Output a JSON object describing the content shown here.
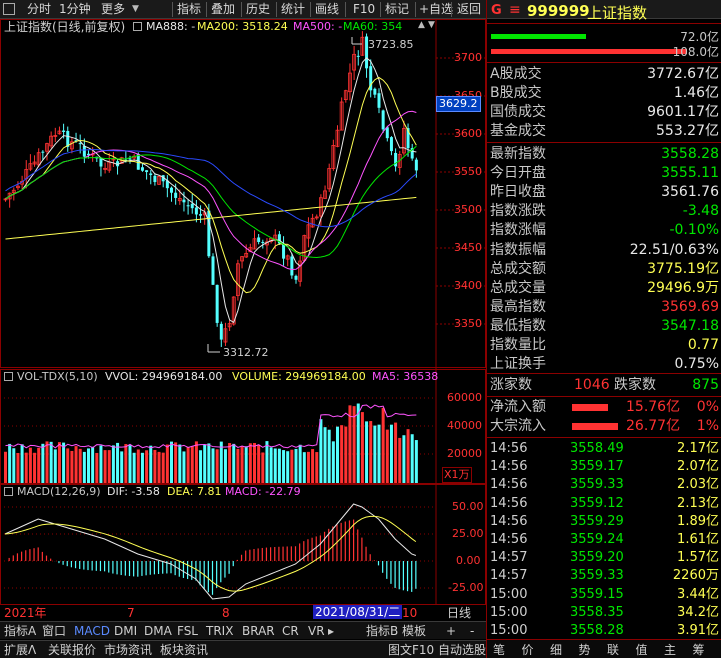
{
  "toolbar": {
    "items": [
      "分时",
      "1分钟",
      "更多",
      "指标",
      "叠加",
      "历史",
      "统计",
      "画线",
      "F10",
      "标记",
      "+自选",
      "返回"
    ]
  },
  "chart": {
    "title": "上证指数(日线,前复权)",
    "ma": [
      {
        "label": "MA888: -",
        "color": "#e8e8e8"
      },
      {
        "label": "MA200: 3518.24",
        "color": "#ffff54"
      },
      {
        "label": "MA500: -",
        "color": "#ff54ff"
      },
      {
        "label": "MA60: 354",
        "color": "#00e600"
      }
    ],
    "price_axis": [
      "3700",
      "3650",
      "3600",
      "3550",
      "3500",
      "3450",
      "3400",
      "3350"
    ],
    "current_price_tag": "3629.2",
    "high_note": "3723.85",
    "low_note": "3312.72",
    "vol_header": [
      {
        "label": "VOL-TDX(5,10)",
        "color": "#c8c8c8"
      },
      {
        "label": "VVOL: 294969184.00",
        "color": "#e8e8e8"
      },
      {
        "label": "VOLUME: 294969184.00",
        "color": "#ffff54"
      },
      {
        "label": "MA5: 36538",
        "color": "#ff54ff"
      }
    ],
    "vol_axis": [
      "60000",
      "40000",
      "20000"
    ],
    "vol_unit": "X1万",
    "macd_header": [
      {
        "label": "MACD(12,26,9)",
        "color": "#c8c8c8"
      },
      {
        "label": "DIF: -3.58",
        "color": "#e8e8e8"
      },
      {
        "label": "DEA: 7.81",
        "color": "#ffff54"
      },
      {
        "label": "MACD: -22.79",
        "color": "#ff54ff"
      }
    ],
    "macd_axis": [
      "50.00",
      "25.00",
      "0.00",
      "-25.00"
    ],
    "date_axis": [
      "2021年",
      "7",
      "8",
      "2021/08/31/二",
      "10"
    ],
    "period_label": "日线"
  },
  "bottom_tabs": [
    "指标A",
    "窗口",
    "MACD",
    "DMI",
    "DMA",
    "FSL",
    "TRIX",
    "BRAR",
    "CR",
    "VR",
    "指标B",
    "模板",
    "+",
    "-"
  ],
  "bottom_tabs2": [
    "扩展Λ",
    "关联报价",
    "市场资讯",
    "板块资讯"
  ],
  "bottom_right": "图文F10 自动选股»",
  "quote": {
    "header_icons": [
      "G",
      "≡"
    ],
    "code": "999999",
    "name": "上证指数",
    "bar_values": [
      "72.0亿",
      "108.0亿"
    ],
    "rows_a": [
      {
        "k": "A股成交",
        "v": "3772.67亿",
        "c": "wht"
      },
      {
        "k": "B股成交",
        "v": "1.46亿",
        "c": "wht"
      },
      {
        "k": "国债成交",
        "v": "9601.17亿",
        "c": "wht"
      },
      {
        "k": "基金成交",
        "v": "553.27亿",
        "c": "wht"
      }
    ],
    "rows_b": [
      {
        "k": "最新指数",
        "v": "3558.28",
        "c": "grn"
      },
      {
        "k": "今日开盘",
        "v": "3555.11",
        "c": "grn"
      },
      {
        "k": "昨日收盘",
        "v": "3561.76",
        "c": "wht"
      },
      {
        "k": "指数涨跌",
        "v": "-3.48",
        "c": "grn"
      },
      {
        "k": "指数涨幅",
        "v": "-0.10%",
        "c": "grn"
      },
      {
        "k": "指数振幅",
        "v": "22.51/0.63%",
        "c": "wht"
      },
      {
        "k": "总成交额",
        "v": "3775.19亿",
        "c": "yel"
      },
      {
        "k": "总成交量",
        "v": "29496.9万",
        "c": "yel"
      },
      {
        "k": "最高指数",
        "v": "3569.69",
        "c": "red"
      },
      {
        "k": "最低指数",
        "v": "3547.18",
        "c": "grn"
      },
      {
        "k": "指数量比",
        "v": "0.77",
        "c": "yel"
      },
      {
        "k": "上证换手",
        "v": "0.75%",
        "c": "wht"
      }
    ],
    "updown": {
      "up_label": "涨家数",
      "up": "1046",
      "down_label": "跌家数",
      "down": "875"
    },
    "flow": [
      {
        "k": "净流入额",
        "v": "15.76亿",
        "pct": "0%"
      },
      {
        "k": "大宗流入",
        "v": "26.77亿",
        "pct": "1%"
      }
    ],
    "ticks": [
      {
        "t": "14:56",
        "p": "3558.49",
        "q": "2.17亿",
        "c": "yel"
      },
      {
        "t": "14:56",
        "p": "3559.17",
        "q": "2.07亿",
        "c": "yel"
      },
      {
        "t": "14:56",
        "p": "3559.33",
        "q": "2.03亿",
        "c": "yel"
      },
      {
        "t": "14:56",
        "p": "3559.12",
        "q": "2.13亿",
        "c": "yel"
      },
      {
        "t": "14:56",
        "p": "3559.29",
        "q": "1.89亿",
        "c": "yel"
      },
      {
        "t": "14:56",
        "p": "3559.24",
        "q": "1.61亿",
        "c": "yel"
      },
      {
        "t": "14:57",
        "p": "3559.20",
        "q": "1.57亿",
        "c": "yel"
      },
      {
        "t": "14:57",
        "p": "3559.33",
        "q": "2260万",
        "c": "yel"
      },
      {
        "t": "15:00",
        "p": "3559.15",
        "q": "3.44亿",
        "c": "yel"
      },
      {
        "t": "15:00",
        "p": "3558.35",
        "q": "34.2亿",
        "c": "yel"
      },
      {
        "t": "15:00",
        "p": "3558.28",
        "q": "3.91亿",
        "c": "yel"
      }
    ],
    "bottom_tabs": [
      "笔",
      "价",
      "细",
      "势",
      "联",
      "值",
      "主",
      "筹"
    ]
  }
}
